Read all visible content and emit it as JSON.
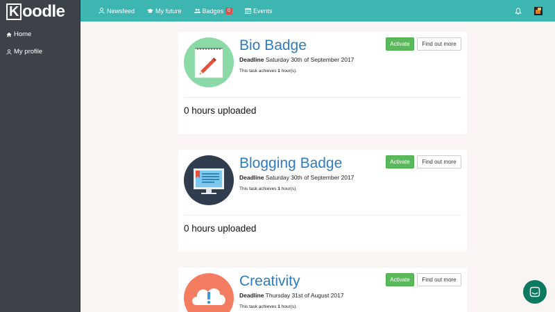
{
  "app": {
    "logo_k": "K",
    "logo_rest": "oodle"
  },
  "sidebar": {
    "items": [
      {
        "label": "Home"
      },
      {
        "label": "My profile"
      }
    ]
  },
  "topnav": {
    "items": [
      {
        "label": "Newsfeed"
      },
      {
        "label": "My future"
      },
      {
        "label": "Badges",
        "count": "0"
      },
      {
        "label": "Events"
      }
    ]
  },
  "cards": [
    {
      "title": "Bio Badge",
      "deadline_label": "Deadline",
      "deadline": "Saturday 30th of September 2017",
      "achieve_pre": "This task achieves ",
      "achieve_hours": "1",
      "achieve_post": " hour(s).",
      "activate": "Activate",
      "more": "Find out more",
      "uploaded": "0 hours uploaded",
      "icon": "notepad-pencil-icon"
    },
    {
      "title": "Blogging Badge",
      "deadline_label": "Deadline",
      "deadline": "Saturday 30th of September 2017",
      "achieve_pre": "This task achieves ",
      "achieve_hours": "1",
      "achieve_post": " hour(s).",
      "activate": "Activate",
      "more": "Find out more",
      "uploaded": "0 hours uploaded",
      "icon": "monitor-blog-icon"
    },
    {
      "title": "Creativity",
      "deadline_label": "Deadline",
      "deadline": "Thursday 31st of August 2017",
      "achieve_pre": "This task achieves ",
      "achieve_hours": "1",
      "achieve_post": " hour(s).",
      "activate": "Activate",
      "more": "Find out more",
      "uploaded": "",
      "icon": "idea-cloud-icon"
    }
  ],
  "colors": {
    "topbar": "#3db5b0",
    "sidebar": "#3d4249",
    "title": "#2d7cbf",
    "activate": "#5cb85c",
    "chat": "#0b7a61"
  }
}
